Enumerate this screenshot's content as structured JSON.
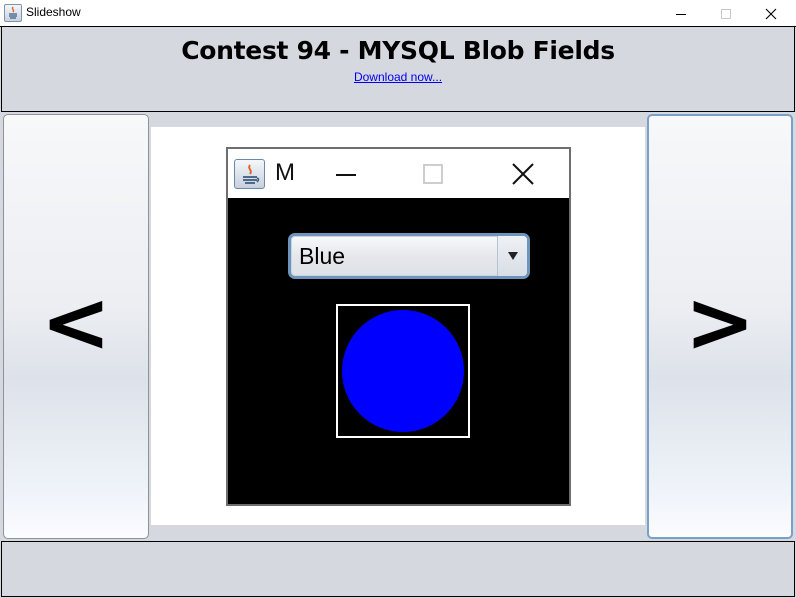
{
  "window": {
    "title": "Slideshow",
    "icon": "java-cup-icon",
    "controls": [
      "minimize",
      "maximize",
      "close"
    ]
  },
  "header": {
    "heading": "Contest 94 - MYSQL Blob Fields",
    "link_text": "Download now..."
  },
  "navigation": {
    "prev_label": "<",
    "next_label": ">"
  },
  "slide": {
    "window": {
      "title": "M",
      "icon": "java-cup-icon",
      "controls": [
        "minimize",
        "maximize",
        "close"
      ]
    },
    "combo": {
      "selected": "Blue"
    },
    "shape": {
      "type": "circle",
      "color": "#0000ff",
      "frame_color": "#ffffff",
      "background": "#000000"
    }
  },
  "colors": {
    "panel_bg": "#d6d8e0",
    "link": "#0000ee",
    "next_button_border": "#7aa0c8"
  }
}
